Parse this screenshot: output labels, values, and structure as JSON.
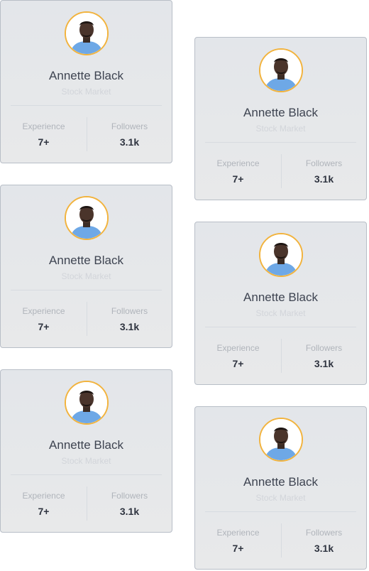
{
  "cards": [
    {
      "name": "Annette Black",
      "subtitle": "Stock Market",
      "stats": [
        {
          "label": "Experience",
          "value": "7+"
        },
        {
          "label": "Followers",
          "value": "3.1k"
        }
      ]
    },
    {
      "name": "Annette Black",
      "subtitle": "Stock Market",
      "stats": [
        {
          "label": "Experience",
          "value": "7+"
        },
        {
          "label": "Followers",
          "value": "3.1k"
        }
      ]
    },
    {
      "name": "Annette Black",
      "subtitle": "Stock Market",
      "stats": [
        {
          "label": "Experience",
          "value": "7+"
        },
        {
          "label": "Followers",
          "value": "3.1k"
        }
      ]
    },
    {
      "name": "Annette Black",
      "subtitle": "Stock Market",
      "stats": [
        {
          "label": "Experience",
          "value": "7+"
        },
        {
          "label": "Followers",
          "value": "3.1k"
        }
      ]
    },
    {
      "name": "Annette Black",
      "subtitle": "Stock Market",
      "stats": [
        {
          "label": "Experience",
          "value": "7+"
        },
        {
          "label": "Followers",
          "value": "3.1k"
        }
      ]
    },
    {
      "name": "Annette Black",
      "subtitle": "Stock Market",
      "stats": [
        {
          "label": "Experience",
          "value": "7+"
        },
        {
          "label": "Followers",
          "value": "3.1k"
        }
      ]
    }
  ],
  "colors": {
    "avatar_ring": "#f2b33d",
    "shirt": "#6ea8e6",
    "card_border": "#b8bec7"
  },
  "icons": {
    "avatar": "person-photo"
  }
}
